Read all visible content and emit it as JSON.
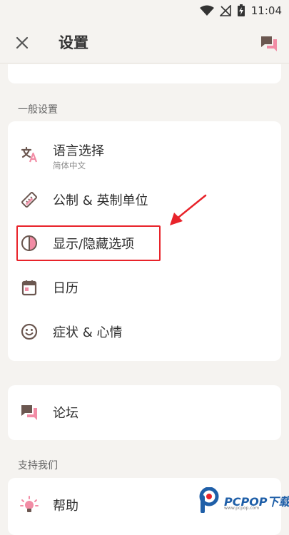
{
  "status_bar": {
    "time": "11:04"
  },
  "app_bar": {
    "title": "设置",
    "close_icon": "close-icon",
    "action_icon": "forum-icon"
  },
  "sections": {
    "general": {
      "header": "一般设置"
    },
    "support": {
      "header": "支持我们"
    }
  },
  "items": {
    "language": {
      "label": "语言选择",
      "subtitle": "简体中文",
      "icon": "translate-icon"
    },
    "units": {
      "label": "公制 & 英制单位",
      "icon": "ruler-icon"
    },
    "show_hide": {
      "label": "显示/隐藏选项",
      "icon": "contrast-icon"
    },
    "calendar": {
      "label": "日历",
      "icon": "calendar-icon"
    },
    "symptoms": {
      "label": "症状 & 心情",
      "icon": "smiley-icon"
    },
    "forum": {
      "label": "论坛",
      "icon": "forum-icon"
    },
    "help": {
      "label": "帮助",
      "icon": "bulb-icon"
    }
  },
  "watermark": {
    "brand": "PCPOP下载",
    "sub": "www.pcpop.com"
  },
  "colors": {
    "accent_pink": "#f28ca5",
    "icon_brown": "#6b5750",
    "highlight_red": "#e8232a",
    "background": "#f5f3f0"
  }
}
